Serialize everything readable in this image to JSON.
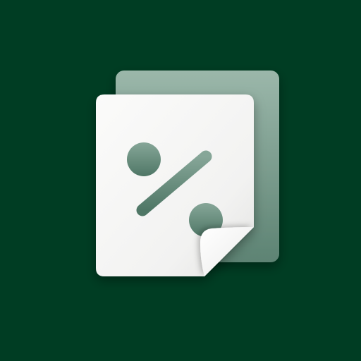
{
  "icon": {
    "name": "percent-document-icon",
    "colors": {
      "background": "#003d23",
      "back_sheet_top": "#9bb7aa",
      "back_sheet_bottom": "#5d8373",
      "front_sheet": "#f7f7f6",
      "front_sheet_shade": "#e6e6e4",
      "cutout_top": "#7fa091",
      "cutout_bottom": "#4f7766",
      "curl": "#ffffff"
    }
  }
}
